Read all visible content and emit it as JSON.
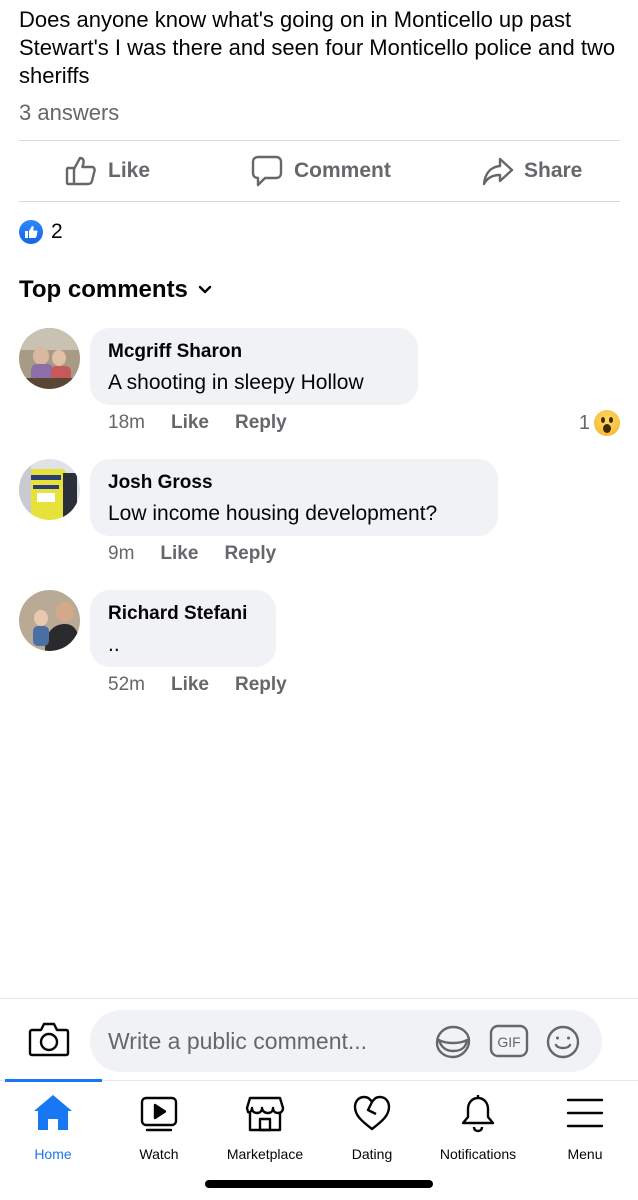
{
  "post": {
    "text": "Does anyone know what's going on in Monticello up past Stewart's I was there and seen four Monticello police and two sheriffs",
    "answers": "3 answers"
  },
  "actions": {
    "like": "Like",
    "comment": "Comment",
    "share": "Share"
  },
  "reactions": {
    "count": "2"
  },
  "top_comments_label": "Top comments",
  "comments": [
    {
      "name": "Mcgriff Sharon",
      "text": "A shooting in sleepy Hollow",
      "time": "18m",
      "like": "Like",
      "reply": "Reply",
      "reaction_count": "1"
    },
    {
      "name": "Josh Gross",
      "text": "Low income housing development?",
      "time": "9m",
      "like": "Like",
      "reply": "Reply"
    },
    {
      "name": "Richard Stefani",
      "text": "..",
      "time": "52m",
      "like": "Like",
      "reply": "Reply"
    }
  ],
  "composer": {
    "placeholder": "Write a public comment...",
    "gif": "GIF"
  },
  "nav": {
    "items": [
      {
        "label": "Home",
        "icon": "home-icon",
        "active": true
      },
      {
        "label": "Watch",
        "icon": "watch-icon"
      },
      {
        "label": "Marketplace",
        "icon": "marketplace-icon"
      },
      {
        "label": "Dating",
        "icon": "dating-icon"
      },
      {
        "label": "Notifications",
        "icon": "bell-icon"
      },
      {
        "label": "Menu",
        "icon": "menu-icon"
      }
    ]
  },
  "colors": {
    "accent": "#1877f2",
    "secondary_text": "#65676b",
    "bubble": "#f0f2f5"
  }
}
